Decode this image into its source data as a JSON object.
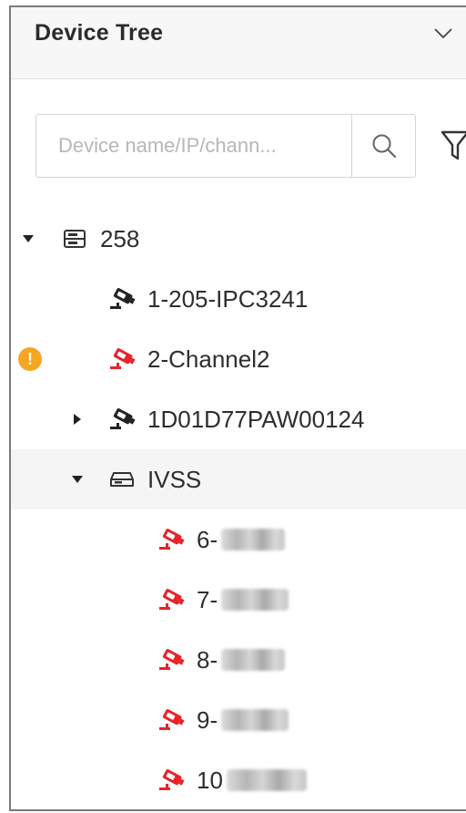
{
  "header": {
    "title": "Device Tree",
    "collapse_icon": "chevron-down-icon"
  },
  "search": {
    "placeholder": "Device name/IP/chann...",
    "value": "",
    "search_icon": "search-icon",
    "filter_icon": "filter-icon"
  },
  "colors": {
    "text": "#2e2e2e",
    "offline": "#e8232b",
    "warning": "#f5a623",
    "selected_bg": "#f5f5f5"
  },
  "tree": [
    {
      "label": "258",
      "type": "server",
      "expanded": true,
      "depth": 0
    },
    {
      "label": "1-205-IPC3241",
      "type": "camera",
      "status": "online",
      "depth": 1
    },
    {
      "label": "2-Channel2",
      "type": "camera",
      "status": "offline",
      "warning": true,
      "depth": 1
    },
    {
      "label": "1D01D77PAW00124",
      "type": "camera",
      "status": "online",
      "expanded": false,
      "depth": 1
    },
    {
      "label": "IVSS",
      "type": "recorder",
      "expanded": true,
      "selected": true,
      "depth": 1
    },
    {
      "label": "6-",
      "type": "camera",
      "status": "offline",
      "depth": 2
    },
    {
      "label": "7-",
      "type": "camera",
      "status": "offline",
      "depth": 2
    },
    {
      "label": "8-",
      "type": "camera",
      "status": "offline",
      "depth": 2
    },
    {
      "label": "9-",
      "type": "camera",
      "status": "offline",
      "depth": 2
    },
    {
      "label": "10",
      "type": "camera",
      "status": "offline",
      "depth": 2
    }
  ]
}
